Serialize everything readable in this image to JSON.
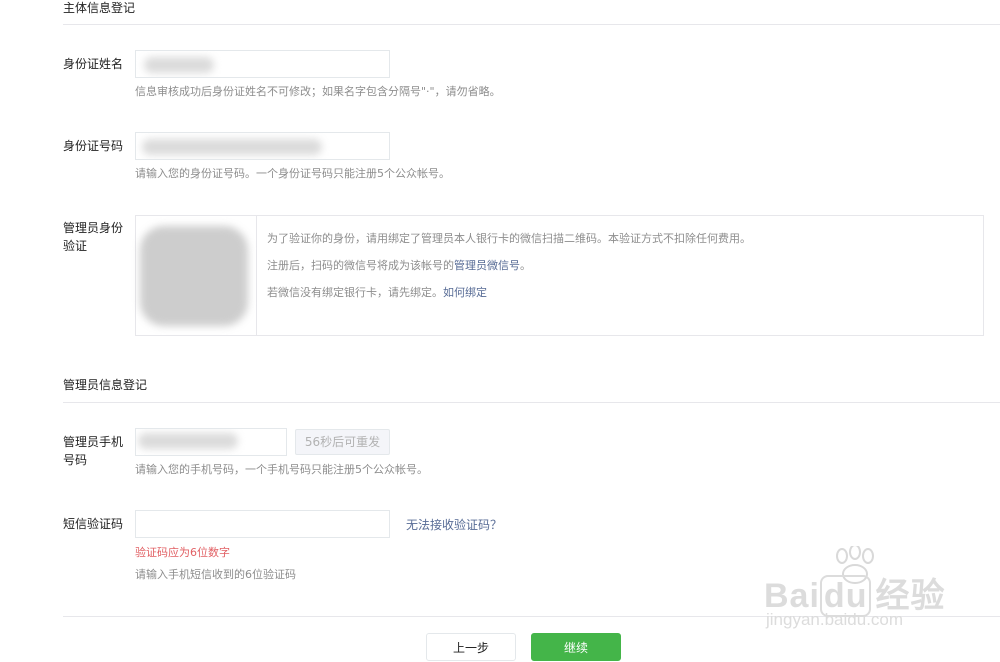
{
  "entity_section": {
    "title": "主体信息登记"
  },
  "id_name": {
    "label": "身份证姓名",
    "hint": "信息审核成功后身份证姓名不可修改；如果名字包含分隔号\"·\"，请勿省略。"
  },
  "id_number": {
    "label": "身份证号码",
    "hint": "请输入您的身份证号码。一个身份证号码只能注册5个公众帐号。"
  },
  "admin_verify": {
    "label_line1": "管理员身份",
    "label_line2": "验证",
    "text1": "为了验证你的身份，请用绑定了管理员本人银行卡的微信扫描二维码。本验证方式不扣除任何费用。",
    "text2_prefix": "注册后，扫码的微信号将成为该帐号的",
    "text2_link": "管理员微信号",
    "text2_suffix": "。",
    "text3_prefix": "若微信没有绑定银行卡，请先绑定。",
    "text3_link": "如何绑定"
  },
  "admin_section": {
    "title": "管理员信息登记"
  },
  "phone": {
    "label_line1": "管理员手机",
    "label_line2": "号码",
    "resend_button": "56秒后可重发",
    "hint": "请输入您的手机号码，一个手机号码只能注册5个公众帐号。"
  },
  "sms": {
    "label": "短信验证码",
    "value": "",
    "cannot_receive_link": "无法接收验证码？",
    "error": "验证码应为6位数字",
    "hint": "请输入手机短信收到的6位验证码"
  },
  "footer": {
    "prev_button": "上一步",
    "continue_button": "继续"
  },
  "watermark": {
    "brand": "Bai",
    "brand_du": "du",
    "brand_cn": "经验",
    "url": "jingyan.baidu.com"
  },
  "colors": {
    "primary": "#44b549",
    "link": "#576b95",
    "error": "#e15f63"
  }
}
